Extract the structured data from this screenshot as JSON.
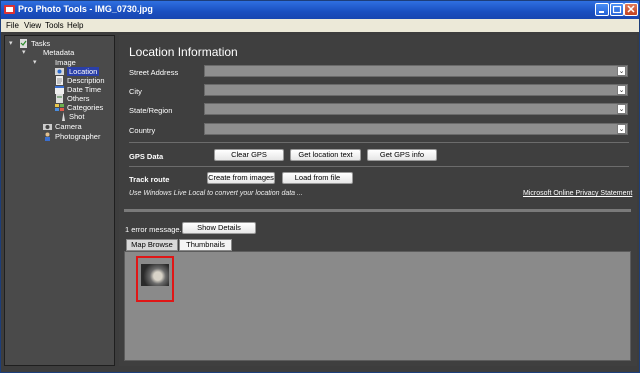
{
  "window": {
    "title": "Pro Photo Tools - IMG_0730.jpg"
  },
  "menu": [
    "File",
    "View",
    "Tools",
    "Help"
  ],
  "tree": {
    "tasks": "Tasks",
    "metadata": "Metadata",
    "image": "Image",
    "location": "Location",
    "description": "Description",
    "date_time": "Date Time",
    "others": "Others",
    "categories": "Categories",
    "shot": "Shot",
    "camera": "Camera",
    "photographer": "Photographer"
  },
  "location": {
    "heading": "Location Information",
    "street_label": "Street Address",
    "city_label": "City",
    "state_label": "State/Region",
    "country_label": "Country"
  },
  "gps": {
    "label": "GPS Data",
    "clear": "Clear GPS",
    "get_location_text": "Get location text",
    "get_gps_info": "Get GPS info"
  },
  "track": {
    "label": "Track route",
    "create_from_images": "Create from images",
    "load_from_file": "Load from file"
  },
  "hint": "Use Windows Live Local to convert your location data ...",
  "privacy_link": "Microsoft Online Privacy Statement",
  "errors": {
    "message": "1 error message.",
    "show_details": "Show Details"
  },
  "tabs": [
    "Map Browse",
    "Thumbnails"
  ],
  "active_tab": "Thumbnails",
  "colors": {
    "title_bar": "#1a4fc0",
    "selection": "#2a3fa8",
    "thumb_highlight": "#e01616"
  }
}
